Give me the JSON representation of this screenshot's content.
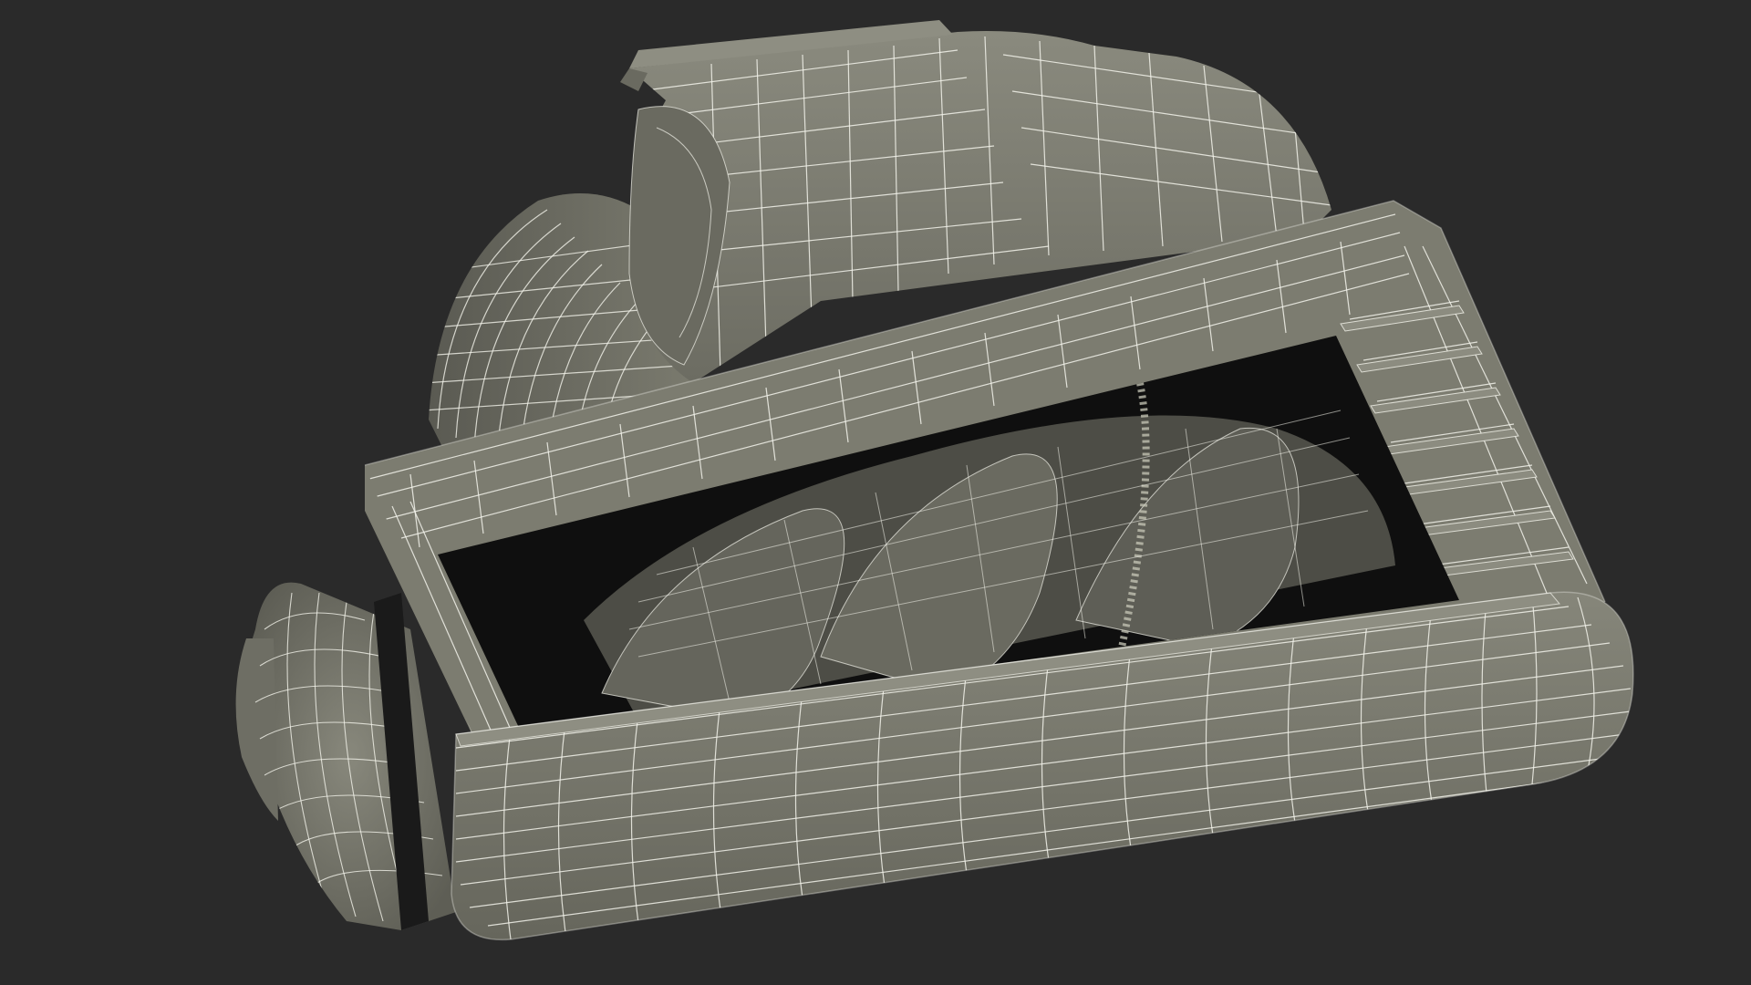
{
  "scene": {
    "subject": "wireframe-render",
    "background_color": "#2a2a2a",
    "surface_color": "#7c7c70",
    "surface_shadow_color": "#5f5f55",
    "interior_color": "#0f0f0f",
    "wire_color": "#f2f2ea",
    "wire_opacity": 0.85
  }
}
